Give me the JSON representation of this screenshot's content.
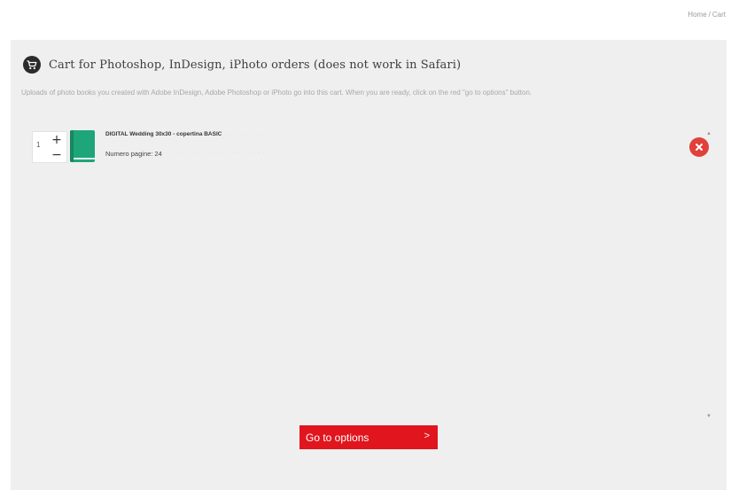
{
  "breadcrumb": {
    "home": "Home",
    "separator": "/",
    "current": "Cart"
  },
  "cart": {
    "title": "Cart for Photoshop, InDesign, iPhoto orders (does not work in Safari)",
    "description": "Uploads of photo books you created with Adobe InDesign, Adobe Photoshop or iPhoto go into this cart. When you are ready, click on the red \"go to options\" button.",
    "icon": "cart-icon"
  },
  "items": [
    {
      "quantity": "1",
      "name": "DIGITAL Wedding 30x30 - copertina BASIC",
      "pages": "Numero pagine: 24",
      "thumb_color": "#1fa57a"
    }
  ],
  "actions": {
    "go_to_options": "Go to options",
    "go_arrow": ">",
    "plus": "+",
    "minus": "−"
  },
  "colors": {
    "accent": "#e1151e",
    "remove": "#e0413a",
    "panel": "#efefef"
  }
}
